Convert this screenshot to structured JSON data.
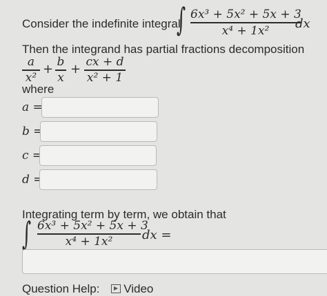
{
  "question": {
    "intro": "Consider the indefinite integral",
    "integrand_numerator": "6x³ + 5x² + 5x + 3",
    "integrand_denominator": "x⁴ + 1x²",
    "dx": "dx",
    "decomposition_text": "Then the integrand has partial fractions decomposition",
    "terms": [
      {
        "num": "a",
        "den": "x²"
      },
      {
        "num": "b",
        "den": "x"
      },
      {
        "num": "cx + d",
        "den": "x² + 1"
      }
    ],
    "plus": "+",
    "where": "where"
  },
  "fields": [
    {
      "label": "a =",
      "value": ""
    },
    {
      "label": "b =",
      "value": ""
    },
    {
      "label": "c =",
      "value": ""
    },
    {
      "label": "d =",
      "value": ""
    }
  ],
  "integration": {
    "text": "Integrating term by term, we obtain that",
    "numerator": "6x³ + 5x² + 5x + 3",
    "denominator": "x⁴ + 1x²",
    "dx_eq": "dx =",
    "answer_value": ""
  },
  "help": {
    "label": "Question Help:",
    "video_label": "Video",
    "icon": "video-icon"
  }
}
